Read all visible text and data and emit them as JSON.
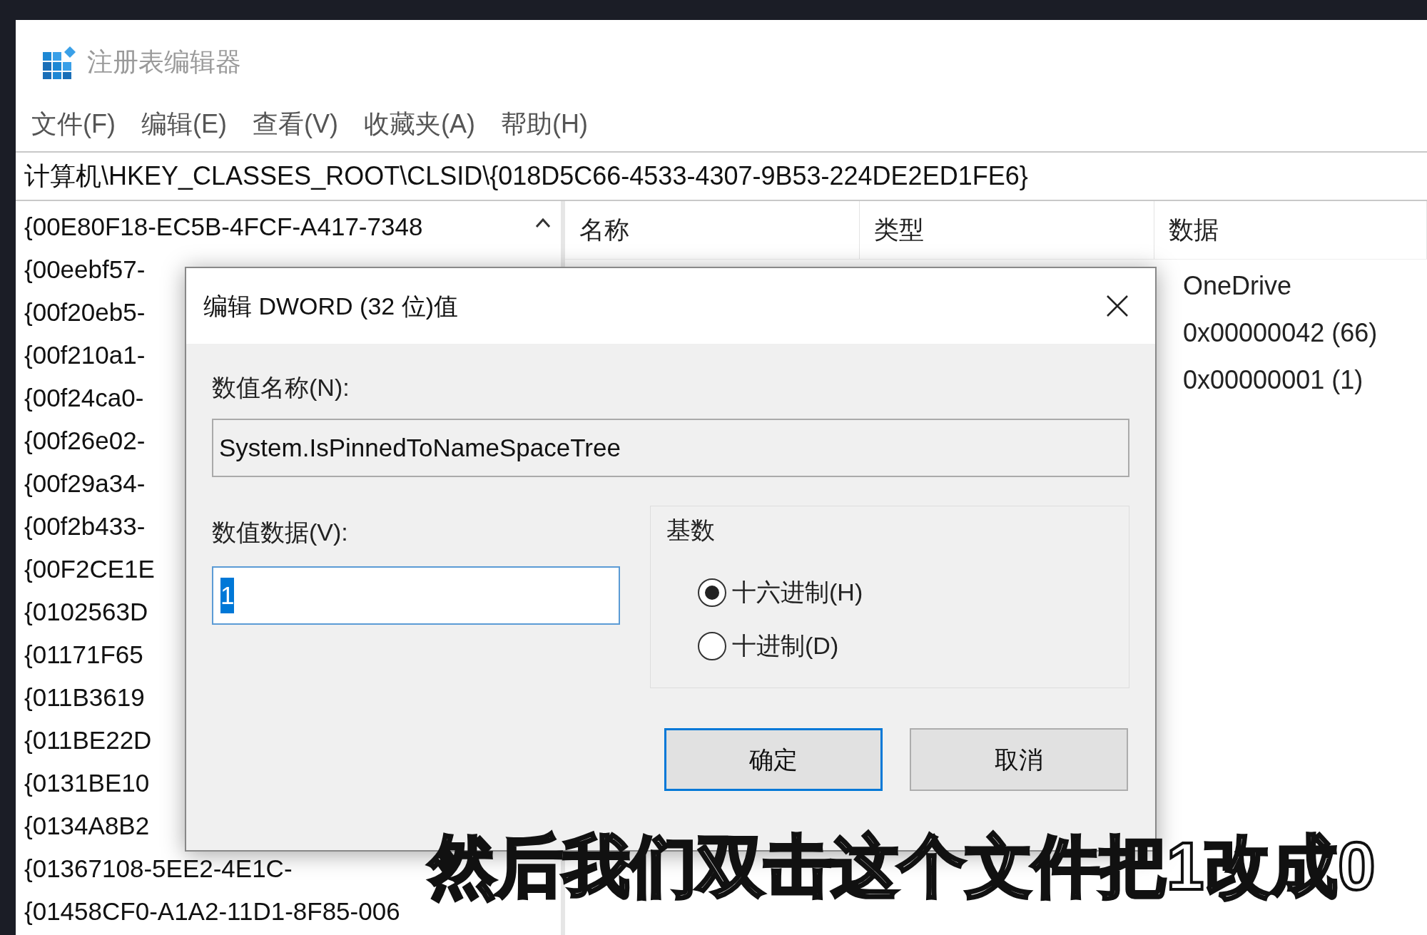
{
  "window": {
    "title": "注册表编辑器"
  },
  "menu": [
    "文件(F)",
    "编辑(E)",
    "查看(V)",
    "收藏夹(A)",
    "帮助(H)"
  ],
  "address": "计算机\\HKEY_CLASSES_ROOT\\CLSID\\{018D5C66-4533-4307-9B53-224DE2ED1FE6}",
  "tree": [
    "{00E80F18-EC5B-4FCF-A417-7348",
    "{00eebf57-",
    "{00f20eb5-",
    "{00f210a1-",
    "{00f24ca0-",
    "{00f26e02-",
    "{00f29a34-",
    "{00f2b433-",
    "{00F2CE1E",
    "{0102563D",
    "{01171F65",
    "{011B3619",
    "{011BE22D",
    "{0131BE10",
    "{0134A8B2",
    "{01367108-5EE2-4E1C-",
    "{01458CF0-A1A2-11D1-8F85-006"
  ],
  "list": {
    "columns": [
      "名称",
      "类型",
      "数据"
    ],
    "data": [
      "OneDrive",
      "0x00000042 (66)",
      "0x00000001 (1)"
    ]
  },
  "dialog": {
    "title": "编辑 DWORD (32 位)值",
    "name_label": "数值名称(N):",
    "name_value": "System.IsPinnedToNameSpaceTree",
    "data_label": "数值数据(V):",
    "data_value": "1",
    "base_label": "基数",
    "radios": [
      {
        "label": "十六进制(H)",
        "selected": true
      },
      {
        "label": "十进制(D)",
        "selected": false
      }
    ],
    "buttons": [
      {
        "label": "确定",
        "default": true
      },
      {
        "label": "取消",
        "default": false
      }
    ]
  },
  "subtitle": "然后我们双击这个文件把1改成0"
}
